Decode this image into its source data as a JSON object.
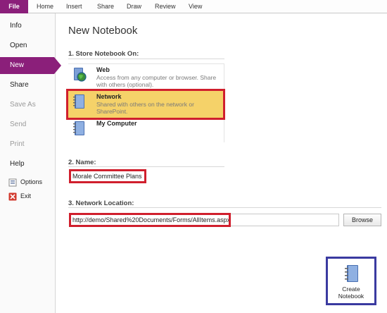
{
  "ribbon": {
    "tabs": [
      "File",
      "Home",
      "Insert",
      "Share",
      "Draw",
      "Review",
      "View"
    ]
  },
  "nav": {
    "items": [
      {
        "label": "Info",
        "state": "normal"
      },
      {
        "label": "Open",
        "state": "normal"
      },
      {
        "label": "New",
        "state": "active"
      },
      {
        "label": "Share",
        "state": "normal"
      },
      {
        "label": "Save As",
        "state": "disabled"
      },
      {
        "label": "Send",
        "state": "disabled"
      },
      {
        "label": "Print",
        "state": "disabled"
      },
      {
        "label": "Help",
        "state": "normal"
      }
    ],
    "options_label": "Options",
    "exit_label": "Exit"
  },
  "main": {
    "title": "New Notebook",
    "store_heading": "1. Store Notebook On:",
    "locations": [
      {
        "name": "Web",
        "desc": "Access from any computer or browser. Share with others (optional).",
        "icon": "web-globe-icon"
      },
      {
        "name": "Network",
        "desc": "Shared with others on the network or SharePoint.",
        "icon": "network-notebook-icon",
        "selected": true
      },
      {
        "name": "My Computer",
        "desc": "",
        "icon": "computer-notebook-icon"
      }
    ],
    "name_heading": "2. Name:",
    "name_value": "Morale Committee Plans",
    "netloc_heading": "3. Network Location:",
    "netloc_value": "http://demo/Shared%20Documents/Forms/AllItems.aspx",
    "browse_label": "Browse",
    "create_label_line1": "Create",
    "create_label_line2": "Notebook"
  },
  "colors": {
    "accent": "#8b1f7a",
    "selection": "#f5d269",
    "highlight_red": "#d01f2d",
    "highlight_blue": "#3a3aa0"
  }
}
